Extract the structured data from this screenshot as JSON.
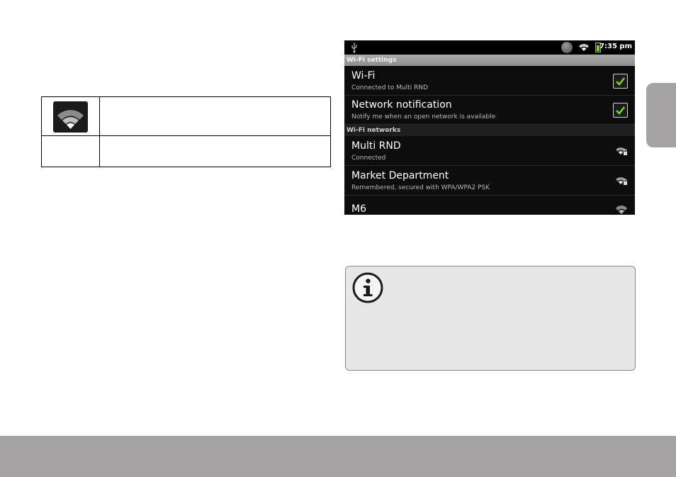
{
  "icon_table": {
    "rows": [
      {
        "icon": "wifi-signal-icon",
        "description": ""
      },
      {
        "icon": "",
        "description": ""
      }
    ]
  },
  "phone": {
    "status_bar": {
      "time": "7:35 pm",
      "icons": [
        "usb-icon",
        "sync-globe-icon",
        "wifi-status-icon",
        "battery-icon"
      ]
    },
    "section_wifi_settings": "Wi-Fi settings",
    "wifi": {
      "title": "Wi-Fi",
      "summary": "Connected to Multi RND",
      "checked": true
    },
    "network_notification": {
      "title": "Network notification",
      "summary": "Notify me when an open network is available",
      "checked": true
    },
    "section_wifi_networks": "Wi-Fi networks",
    "networks": [
      {
        "name": "Multi RND",
        "status": "Connected",
        "secured": true
      },
      {
        "name": "Market Department",
        "status": "Remembered, secured with WPA/WPA2 PSK",
        "secured": true
      },
      {
        "name": "M6",
        "status": "",
        "secured": false
      }
    ]
  },
  "note": {
    "icon": "info-icon",
    "text": ""
  },
  "colors": {
    "phone_bg": "#0d0d0d",
    "checkmark": "#7ad12a",
    "header_bar": "#a9a9a9",
    "note_bg": "#e6e6e7",
    "footer": "#a5a3a4"
  }
}
